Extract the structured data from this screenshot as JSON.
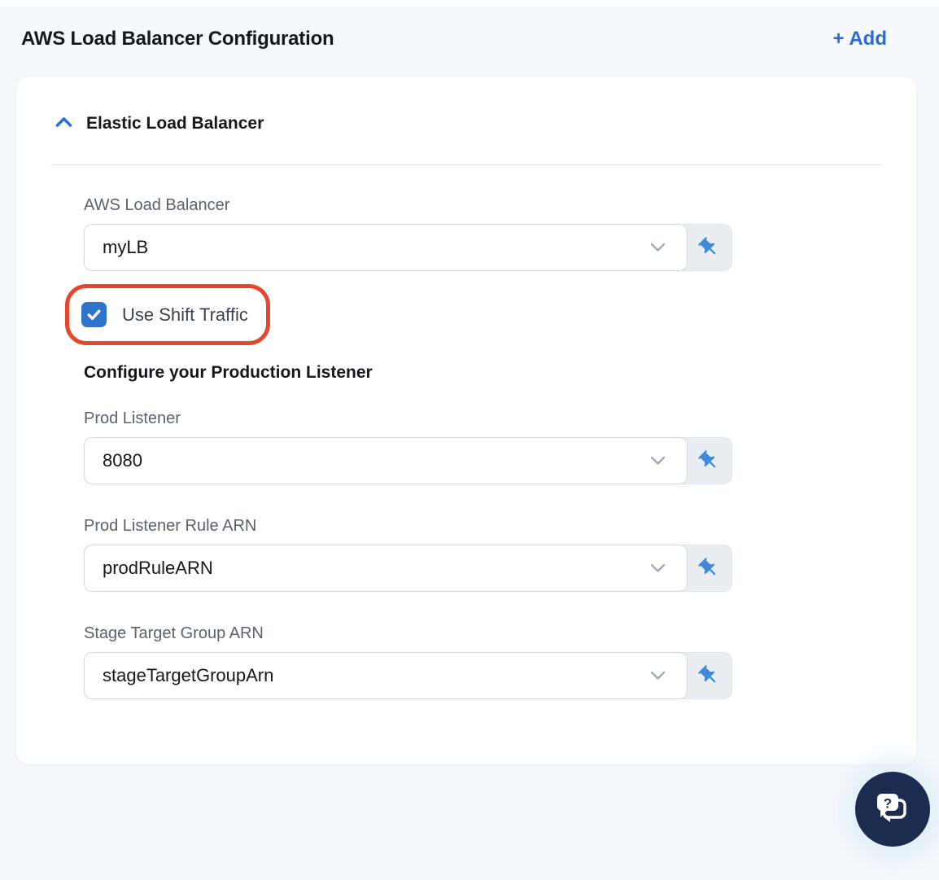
{
  "header": {
    "title": "AWS Load Balancer Configuration",
    "add_label": "+ Add"
  },
  "panel": {
    "section_title": "Elastic Load Balancer",
    "subheading": "Configure your Production Listener",
    "checkbox": {
      "label": "Use Shift Traffic",
      "checked": "true"
    },
    "fields": [
      {
        "id": "aws-load-balancer",
        "label": "AWS Load Balancer",
        "value": "myLB"
      },
      {
        "id": "prod-listener",
        "label": "Prod Listener",
        "value": "8080"
      },
      {
        "id": "prod-listener-rule-arn",
        "label": "Prod Listener Rule ARN",
        "value": "prodRuleARN"
      },
      {
        "id": "stage-target-group-arn",
        "label": "Stage Target Group ARN",
        "value": "stageTargetGroupArn"
      }
    ]
  },
  "icons": {
    "collapse": "chevron-up",
    "dropdown": "chevron-down",
    "pin": "pushpin",
    "help": "chat-question"
  },
  "colors": {
    "accent": "#2c6bd3",
    "checkbox_checked": "#2e74cc",
    "annotation_outline": "#e8462c",
    "pin_icon": "#3e8bd9",
    "help_bubble_bg": "#1c2c51",
    "page_background": "#f6f9fc"
  }
}
